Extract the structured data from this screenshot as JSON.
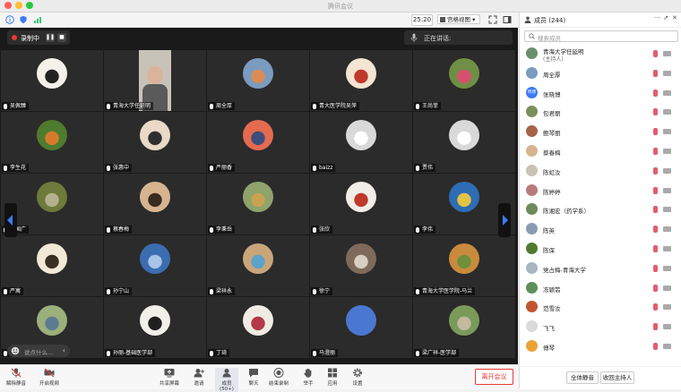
{
  "window": {
    "title": "腾讯会议"
  },
  "topbar": {
    "timer": "25:20",
    "view_label": "宫格视图"
  },
  "recording": {
    "label": "录制中"
  },
  "speaking": {
    "label": "正在讲话:"
  },
  "participants": [
    {
      "name": "吴佩臻",
      "avatar": "#f4f1ea",
      "accent": "#222"
    },
    {
      "name": "青海大学任延明",
      "avatar": "#c8c3b8",
      "accent": "#5a5a5a",
      "video": true
    },
    {
      "name": "周全厚",
      "avatar": "#7b9bbf",
      "accent": "#d98c56"
    },
    {
      "name": "青大医学院吴萍",
      "avatar": "#f3e4d3",
      "accent": "#c0392b"
    },
    {
      "name": "王尚菲",
      "avatar": "#6e8f45",
      "accent": "#d74f6f"
    },
    {
      "name": "李生花",
      "avatar": "#4f7b2f",
      "accent": "#d67b2c"
    },
    {
      "name": "张惠中",
      "avatar": "#e9d9c6",
      "accent": "#2f2f2f"
    },
    {
      "name": "严丽香",
      "avatar": "#e46b4f",
      "accent": "#3b4e7b"
    },
    {
      "name": "baizz",
      "avatar": "#d9d9d9",
      "accent": "#ffffff"
    },
    {
      "name": "贾伟",
      "avatar": "#d9d9d9",
      "accent": "#ffffff"
    },
    {
      "name": "罗国广",
      "avatar": "#6d7a3a",
      "accent": "#b5b08d"
    },
    {
      "name": "蔡春梅",
      "avatar": "#d6b48f",
      "accent": "#3a2a1f"
    },
    {
      "name": "李秉岳",
      "avatar": "#8fa36b",
      "accent": "#c9a24e"
    },
    {
      "name": "张欣",
      "avatar": "#f1ede7",
      "accent": "#c0392b"
    },
    {
      "name": "李伟",
      "avatar": "#2e6db5",
      "accent": "#e3c343"
    },
    {
      "name": "严寓",
      "avatar": "#f1e8d6",
      "accent": "#3a2f24"
    },
    {
      "name": "孙宁山",
      "avatar": "#3b6db0",
      "accent": "#a9c4e8"
    },
    {
      "name": "梁祥永",
      "avatar": "#c9a57a",
      "accent": "#5ba3c9"
    },
    {
      "name": "徐宁",
      "avatar": "#7f6a5a",
      "accent": "#d8cfc2"
    },
    {
      "name": "青海大学医学院-马兰",
      "avatar": "#c98a3d",
      "accent": "#6f8f3a"
    },
    {
      "name": "冯忽利",
      "avatar": "#9bb07a",
      "accent": "#5d7a93"
    },
    {
      "name": "孙丽-基础医学部",
      "avatar": "#f0efe9",
      "accent": "#1f1f1f"
    },
    {
      "name": "丁琦",
      "avatar": "#efece4",
      "accent": "#b23a48"
    },
    {
      "name": "马澄丽",
      "avatar": "#4a78d0",
      "accent": "#4a78d0"
    },
    {
      "name": "梁广祥-医学部",
      "avatar": "#7a9a5a",
      "accent": "#c5b9a0"
    }
  ],
  "chat_placeholder": "说点什么...",
  "toolbar": {
    "mute": "解除静音",
    "video": "开启视频",
    "share": "共享屏幕",
    "invite": "邀请",
    "members": "成员(50+)",
    "chat": "聊天",
    "record": "结束录制",
    "raise": "举手",
    "apps": "应用",
    "settings": "设置",
    "leave": "离开会议"
  },
  "panel": {
    "title": "成员 (244)",
    "search_placeholder": "搜索成员",
    "members": [
      {
        "name": "青海大学任延明",
        "sub": "(主持人)",
        "color": "#6b8f6a"
      },
      {
        "name": "周全厚",
        "sub": "",
        "color": "#7b9bbf"
      },
      {
        "name": "张晓博",
        "sub": "",
        "color": "#3d7bf7",
        "initials": "晓博"
      },
      {
        "name": "包君丽",
        "sub": "",
        "color": "#7b8f5a"
      },
      {
        "name": "鲍琴丽",
        "sub": "",
        "color": "#a7634a"
      },
      {
        "name": "蔡春梅",
        "sub": "",
        "color": "#d6b48f"
      },
      {
        "name": "陈虹汝",
        "sub": "",
        "color": "#c9c1b2"
      },
      {
        "name": "陈婷婷",
        "sub": "",
        "color": "#b87b7b"
      },
      {
        "name": "陈湘宏（药学系）",
        "sub": "",
        "color": "#6f8a58"
      },
      {
        "name": "陈英",
        "sub": "",
        "color": "#8a9bb0"
      },
      {
        "name": "陈保",
        "sub": "",
        "color": "#4f7b2f"
      },
      {
        "name": "党占梅-青海大学",
        "sub": "",
        "color": "#a8b5c2"
      },
      {
        "name": "冻颖翡",
        "sub": "",
        "color": "#5e8f5a"
      },
      {
        "name": "范雪汝",
        "sub": "",
        "color": "#c3532f"
      },
      {
        "name": "飞飞",
        "sub": "",
        "color": "#d9d9d9"
      },
      {
        "name": "傅琴",
        "sub": "",
        "color": "#e9a437"
      }
    ],
    "mute_all": "全体静音",
    "reclaim_host": "收回主持人"
  },
  "colors": {
    "accent": "#3d7bf7",
    "danger": "#e53935"
  }
}
